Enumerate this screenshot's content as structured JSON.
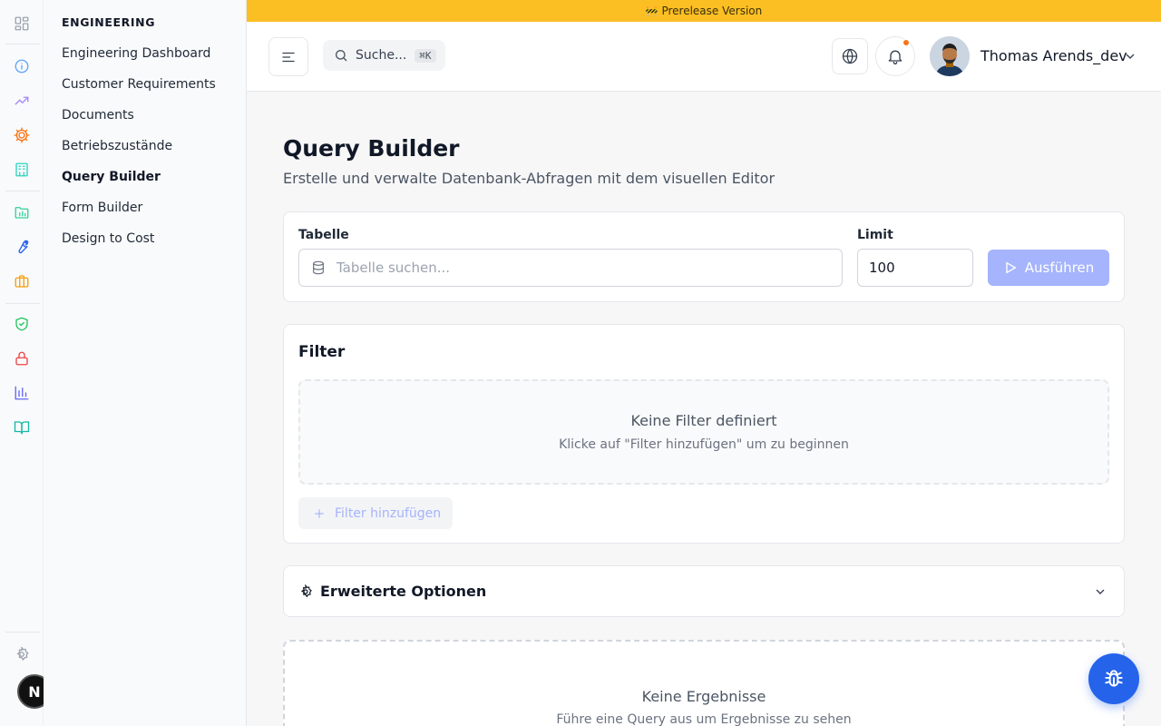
{
  "rail": {
    "icons": [
      {
        "name": "grid-icon",
        "color": "#9ca3af"
      },
      {
        "name": "info-icon",
        "color": "#60a5fa"
      },
      {
        "name": "trending-up-icon",
        "color": "#a78bfa"
      },
      {
        "name": "cog-icon",
        "color": "#f97316"
      },
      {
        "name": "building-icon",
        "color": "#2dd4bf"
      },
      {
        "name": "folder-chart-icon",
        "color": "#34d399"
      },
      {
        "name": "wrench-icon",
        "color": "#2563eb"
      },
      {
        "name": "briefcase-icon",
        "color": "#f59e0b"
      },
      {
        "name": "shield-check-icon",
        "color": "#22c55e"
      },
      {
        "name": "lock-icon",
        "color": "#ef4444"
      },
      {
        "name": "bar-chart-icon",
        "color": "#6366f1"
      },
      {
        "name": "book-open-icon",
        "color": "#14b8a6"
      },
      {
        "name": "settings-icon",
        "color": "#9ca3af"
      }
    ],
    "badge_label": "N"
  },
  "subnav": {
    "title": "ENGINEERING",
    "items": [
      {
        "label": "Engineering Dashboard",
        "active": false
      },
      {
        "label": "Customer Requirements",
        "active": false
      },
      {
        "label": "Documents",
        "active": false
      },
      {
        "label": "Betriebszustände",
        "active": false
      },
      {
        "label": "Query Builder",
        "active": true
      },
      {
        "label": "Form Builder",
        "active": false
      },
      {
        "label": "Design to Cost",
        "active": false
      }
    ]
  },
  "banner": {
    "icon": "🚧",
    "text": "Prerelease Version",
    "color": "#fbbf24"
  },
  "header": {
    "search_placeholder": "Suche...",
    "search_shortcut": "⌘K",
    "user_name": "Thomas Arends_dev",
    "has_notification": true
  },
  "main": {
    "title": "Query Builder",
    "subtitle": "Erstelle und verwalte Datenbank-Abfragen mit dem visuellen Editor",
    "query": {
      "table_label": "Tabelle",
      "table_placeholder": "Tabelle suchen...",
      "limit_label": "Limit",
      "limit_value": "100",
      "run_label": "Ausführen"
    },
    "filter": {
      "title": "Filter",
      "empty_title": "Keine Filter definiert",
      "empty_subtitle": "Klicke auf \"Filter hinzufügen\" um zu beginnen",
      "add_label": "Filter hinzufügen"
    },
    "advanced": {
      "label": "Erweiterte Optionen"
    },
    "results": {
      "empty_title": "Keine Ergebnisse",
      "empty_subtitle": "Führe eine Query aus um Ergebnisse zu sehen"
    }
  },
  "colors": {
    "accent": "#2563eb",
    "run_button": "#a5b4fc",
    "notification": "#f97316"
  }
}
